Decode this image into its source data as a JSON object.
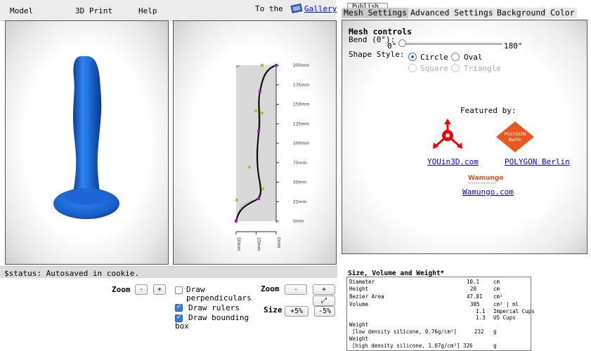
{
  "menu": {
    "items": [
      "Model",
      "3D Print",
      "Help"
    ],
    "gallery_prefix": "To the",
    "gallery_link": "Gallery",
    "publish": "Publish"
  },
  "tabs": [
    {
      "label": "Mesh Settings",
      "active": true
    },
    {
      "label": "Advanced Settings",
      "active": false
    },
    {
      "label": "Background",
      "active": false
    },
    {
      "label": "Color",
      "active": false
    }
  ],
  "mesh": {
    "title": "Mesh controls",
    "bend_label": "Bend (0°):",
    "bend_min": "0°",
    "bend_max": "180°",
    "bend_value_fraction": 0.0,
    "shape_label": "Shape Style:",
    "shapes": [
      {
        "label": "Circle",
        "checked": true,
        "enabled": true
      },
      {
        "label": "Oval",
        "checked": false,
        "enabled": true
      },
      {
        "label": "Square",
        "checked": false,
        "enabled": false
      },
      {
        "label": "Triangle",
        "checked": false,
        "enabled": false
      }
    ],
    "featured_label": "Featured by:",
    "sponsors": [
      {
        "link": "YOUin3D.com"
      },
      {
        "link": "POLYGON Berlin",
        "logo_text": "POLYGON Berlin"
      },
      {
        "link": "Wamungo.com",
        "logo_text": "Wamungo",
        "logo_sub": "3D-Druck Alles für Alle"
      }
    ]
  },
  "ruler": {
    "right_ticks": [
      "200mm",
      "175mm",
      "150mm",
      "125mm",
      "100mm",
      "75mm",
      "50mm",
      "25mm",
      "0mm"
    ],
    "bottom_ticks": [
      "50mm",
      "25mm",
      "0mm"
    ]
  },
  "status": "$status: Autosaved in cookie.",
  "controls": {
    "zoom_label": "Zoom",
    "zoom_minus": "-",
    "zoom_plus": "+",
    "draw_perpendiculars": {
      "label": "Draw perpendiculars",
      "checked": false
    },
    "draw_rulers": {
      "label": "Draw rulers",
      "checked": true
    },
    "draw_bounding_box": {
      "label": "Draw bounding box",
      "checked": true
    },
    "zoom2_label": "Zoom",
    "zoom2_minus": "-",
    "zoom2_plus": "+",
    "fit_icon": "⤢",
    "size_label": "Size",
    "size_plus": "+5%",
    "size_minus": "-5%"
  },
  "info": {
    "title": "Size, Volume and Weight*",
    "rows": [
      {
        "name": "Diameter",
        "value": "10.1",
        "unit": "cm"
      },
      {
        "name": "Height",
        "value": "20",
        "unit": "cm"
      },
      {
        "name": "Bezier Area",
        "value": "47.81",
        "unit": "cm²"
      },
      {
        "name": "Volume",
        "value": "305",
        "unit": "cm³ | ml"
      }
    ],
    "volume_extra": [
      {
        "value": "1.1",
        "unit": "Imperial Cups"
      },
      {
        "value": "1.3",
        "unit": "US Cups"
      }
    ],
    "weights": [
      {
        "name": "Weight",
        "desc": "[low density silicone, 0.76g/cm³]",
        "value": "232",
        "unit": "g"
      },
      {
        "name": "Weight",
        "desc": "[high density silicone, 1.07g/cm³]",
        "value": "326",
        "unit": "g"
      }
    ]
  },
  "colors": {
    "model_blue": "#1f6fe0",
    "link": "#0000ee",
    "curve_point": "#9c27b0",
    "control_point": "#9ccc3c"
  }
}
